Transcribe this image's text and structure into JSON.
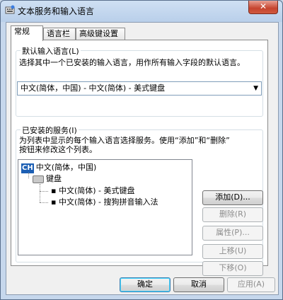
{
  "window": {
    "title": "文本服务和输入语言",
    "close_glyph": "✕"
  },
  "tabs": [
    "常规",
    "语言栏",
    "高级键设置"
  ],
  "default_lang": {
    "group_title": "默认输入语言(L)",
    "description": "选择其中一个已安装的输入语言，用作所有输入字段的默认语言。",
    "selected": "中文(简体，中国) - 中文(简体) - 美式键盘"
  },
  "installed": {
    "group_title": "已安装的服务(I)",
    "description_line1": "为列表中显示的每个输入语言选择服务。使用“添加”和“删除”",
    "description_line2": "按钮来修改这个列表。",
    "badge": "CH",
    "language": "中文(简体，中国)",
    "category": "键盘",
    "items": [
      "中文(简体) - 美式键盘",
      "中文(简体) - 搜狗拼音输入法"
    ]
  },
  "side_buttons": {
    "add": "添加(D)...",
    "remove": "删除(R)",
    "properties": "属性(P)...",
    "move_up": "上移(U)",
    "move_down": "下移(O)"
  },
  "footer": {
    "ok": "确定",
    "cancel": "取消",
    "apply": "应用(A)"
  }
}
